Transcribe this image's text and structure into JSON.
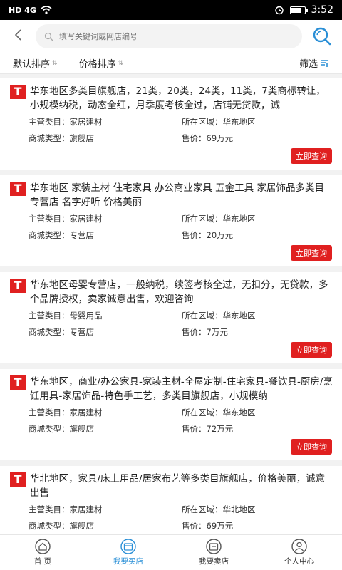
{
  "statusbar": {
    "left": "HD 4G",
    "time": "3:52"
  },
  "search": {
    "placeholder": "填写关键词或网店编号"
  },
  "sort": {
    "default": "默认排序",
    "price": "价格排序",
    "filter": "筛选"
  },
  "labels": {
    "category": "主营类目：",
    "region": "所在区域：",
    "type": "商城类型：",
    "price": "售价：",
    "query": "立即查询"
  },
  "logo": "T",
  "listings": [
    {
      "title": "华东地区多类目旗舰店，21类，20类，24类，11类，7类商标转让，小规模纳税，动态全红，月季度考核全过，店铺无贷款，诚",
      "category": "家居建材",
      "region": "华东地区",
      "type": "旗舰店",
      "price": "69万元"
    },
    {
      "title": "华东地区 家装主材 住宅家具 办公商业家具 五金工具 家居饰品多类目专营店 名字好听 价格美丽",
      "category": "家居建材",
      "region": "华东地区",
      "type": "专营店",
      "price": "20万元"
    },
    {
      "title": "华东地区母婴专营店，一般纳税，续签考核全过，无扣分，无贷款，多个品牌授权，卖家诚意出售，欢迎咨询",
      "category": "母婴用品",
      "region": "华东地区",
      "type": "专营店",
      "price": "7万元"
    },
    {
      "title": "华东地区，商业/办公家具-家装主材-全屋定制-住宅家具-餐饮具-厨房/烹饪用具-家居饰品-特色手工艺，多类目旗舰店，小规模纳",
      "category": "家居建材",
      "region": "华东地区",
      "type": "旗舰店",
      "price": "72万元"
    },
    {
      "title": "华北地区，家具/床上用品/居家布艺等多类目旗舰店，价格美丽，诚意出售",
      "category": "家居建材",
      "region": "华北地区",
      "type": "旗舰店",
      "price": "69万元"
    }
  ],
  "tabs": [
    {
      "label": "首 页",
      "icon": "home-icon"
    },
    {
      "label": "我要买店",
      "icon": "shop-buy-icon"
    },
    {
      "label": "我要卖店",
      "icon": "shop-sell-icon"
    },
    {
      "label": "个人中心",
      "icon": "user-icon"
    }
  ],
  "colors": {
    "accent": "#2a8fd6",
    "brand_red": "#e02020"
  }
}
